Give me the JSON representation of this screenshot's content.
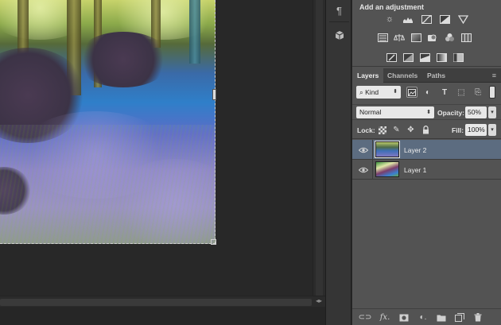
{
  "adjustments": {
    "title": "Add an adjustment",
    "row1": [
      "brightness-contrast-icon",
      "levels-icon",
      "curves-icon",
      "exposure-icon",
      "gradient-triangle-icon"
    ],
    "row2": [
      "vibrance-icon",
      "color-balance-icon",
      "black-white-icon",
      "photo-filter-icon",
      "channel-mixer-icon",
      "color-lookup-icon"
    ],
    "row3": [
      "invert-icon",
      "posterize-icon",
      "threshold-icon",
      "gradient-map-icon",
      "selective-color-icon"
    ]
  },
  "dock": {
    "items": [
      "paragraph-icon",
      "3d-cube-icon"
    ]
  },
  "layers_panel": {
    "tabs": [
      {
        "label": "Layers",
        "active": true
      },
      {
        "label": "Channels",
        "active": false
      },
      {
        "label": "Paths",
        "active": false
      }
    ],
    "filter": {
      "kind_label": "Kind"
    },
    "blend_mode": "Normal",
    "opacity_label": "Opacity:",
    "opacity_value": "50%",
    "lock_label": "Lock:",
    "fill_label": "Fill:",
    "fill_value": "100%",
    "layers": [
      {
        "name": "Layer 2",
        "selected": true,
        "visible": true
      },
      {
        "name": "Layer 1",
        "selected": false,
        "visible": true
      }
    ]
  },
  "colors": {
    "panel_bg": "#535353",
    "selected_layer": "#5c6c80",
    "workspace_bg": "#282828"
  }
}
